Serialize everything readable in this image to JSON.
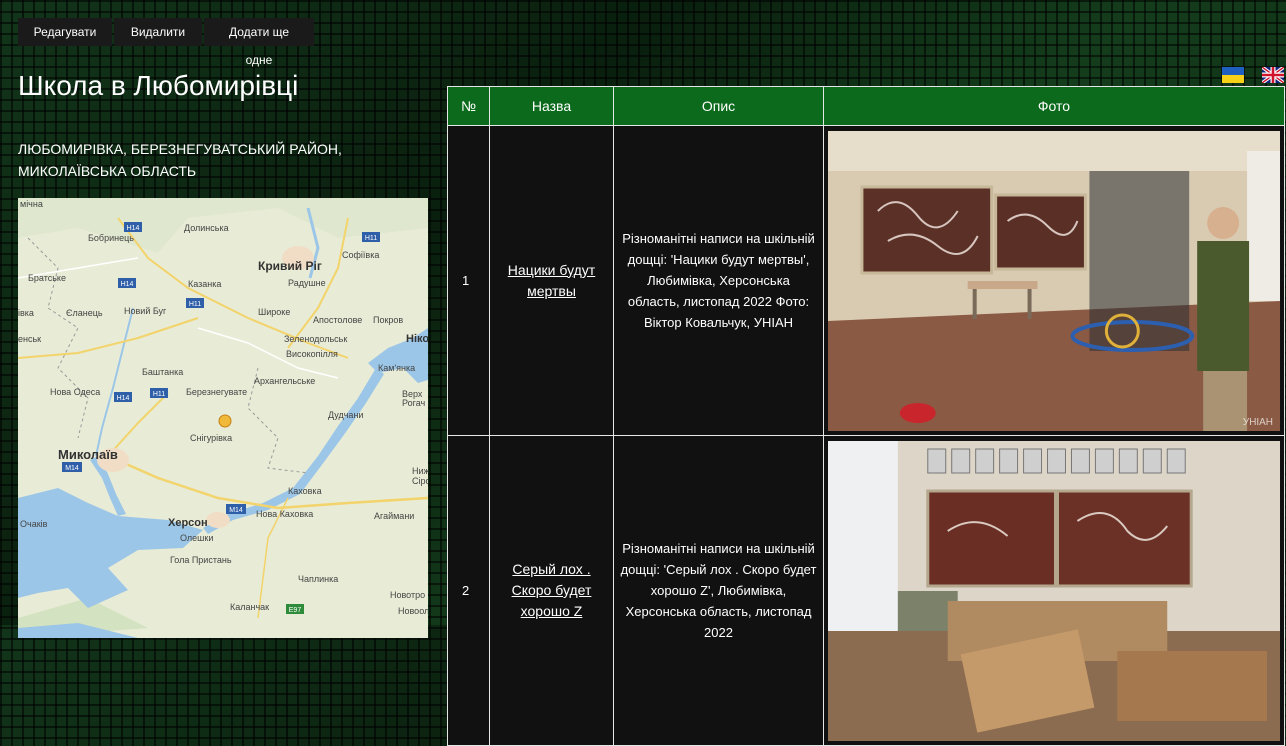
{
  "toolbar": {
    "edit_label": "Редагувати",
    "delete_label": "Видалити",
    "add_label": "Додати ще одне"
  },
  "page": {
    "title": "Школа в Любомирівці",
    "address": "Любомирівка, Березнегуватський район, Миколаївська область"
  },
  "languages": [
    {
      "code": "ua",
      "icon": "ukraine-flag-icon"
    },
    {
      "code": "en",
      "icon": "uk-flag-icon"
    }
  ],
  "map": {
    "labels": {
      "mishchyn": "мічна",
      "dolynska": "Долинська",
      "bobrynets": "Бобринець",
      "sofiivka": "Софіївка",
      "kryvyi_rih": "Кривий Ріг",
      "bratske": "Братське",
      "kazanka": "Казанка",
      "radushne": "Радушне",
      "yelanets": "Єланець",
      "novyi_buh": "Новий Буг",
      "shyroke": "Широке",
      "apostolove": "Апостолове",
      "pokrov": "Покров",
      "ivka": "івка",
      "ensk": "енськ",
      "zelenodolsk": "Зеленодольськ",
      "nikopol": "Нікоп",
      "vysokopillia": "Високопілля",
      "kamianka": "Кам'янка",
      "bashtanka": "Баштанка",
      "arkhanhelske": "Архангельське",
      "nova_odesa": "Нова Одеса",
      "bereznehuvate": "Березнегувате",
      "verkh": "Верх",
      "rohach": "Рогач",
      "dudchany": "Дудчани",
      "snihurivka": "Снігурівка",
      "mykolaiv": "Миколаїв",
      "nyzh": "Ниж",
      "sirog": "Сірог",
      "kakhovka": "Каховка",
      "nova_kakhovka": "Нова Каховка",
      "ahaimany": "Агаймани",
      "ochakiv": "Очаків",
      "kherson": "Херсон",
      "oleshky": "Олешки",
      "hola_prystan": "Гола Пристань",
      "chaplynka": "Чаплинка",
      "novotr": "Новотро",
      "kalanchak": "Каланчак",
      "novool": "Новоол",
      "h14": "H14",
      "h11": "H11",
      "m14": "M14",
      "e97": "E97"
    }
  },
  "table": {
    "columns": [
      "№",
      "Назва",
      "Опис",
      "Фото"
    ],
    "rows": [
      {
        "num": "1",
        "name": "Нацики будут мертвы",
        "description": "Різноманітні написи на шкільній дощці: 'Нацики будут мертвы', Любимівка, Херсонська область, листопад 2022 Фото: Віктор Ковальчук, УНІАН"
      },
      {
        "num": "2",
        "name": "Серый лох . Скоро будет хорошо Z",
        "description": "Різноманітні написи на шкільній дощці: 'Серый лох . Скоро будет хорошо Z', Любимівка, Херсонська область, листопад 2022"
      }
    ],
    "watermark": "УНІАН"
  },
  "colors": {
    "header_green": "#0b6a1c",
    "cell_bg": "#111111",
    "button_bg": "#1a1a1a"
  }
}
